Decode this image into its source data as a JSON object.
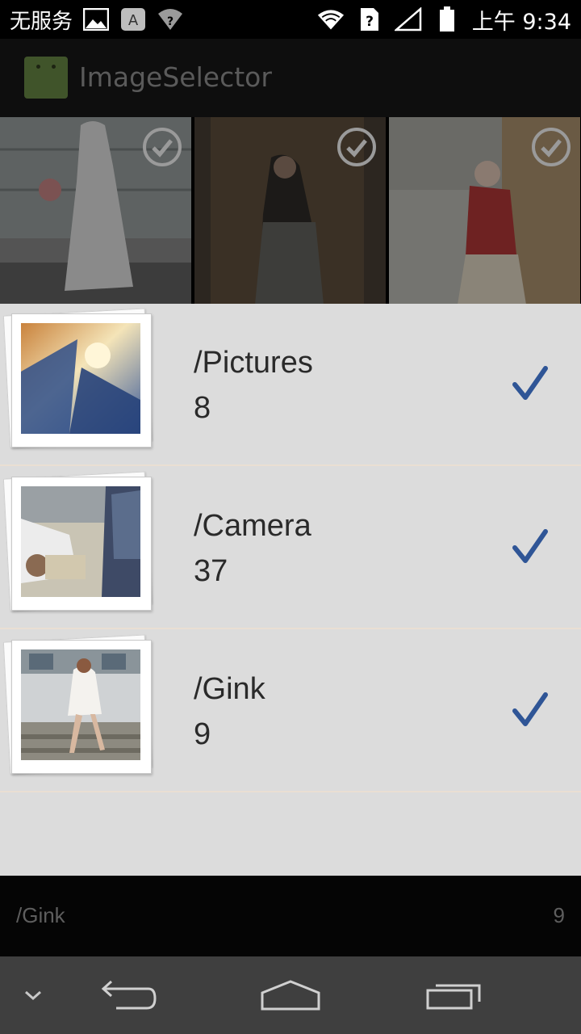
{
  "status_bar": {
    "carrier": "无服务",
    "time": "上午 9:34",
    "icons": [
      "gallery-notification-icon",
      "keyboard-a-icon",
      "wifi-question-icon",
      "wifi-icon",
      "sim-unknown-icon",
      "signal-icon",
      "battery-icon"
    ]
  },
  "action_bar": {
    "title": "ImageSelector",
    "icon": "android-app-icon"
  },
  "grid": {
    "thumbnails": [
      "photo-woman-white-dress",
      "photo-woman-dark-room",
      "photo-woman-red-sweater"
    ]
  },
  "folders": [
    {
      "name": "/Pictures",
      "count": "8",
      "selected": true
    },
    {
      "name": "/Camera",
      "count": "37",
      "selected": true
    },
    {
      "name": "/Gink",
      "count": "9",
      "selected": true
    }
  ],
  "bottom_bar": {
    "current_dir": "/Gink",
    "image_count": "9"
  },
  "nav_bar": {
    "buttons": [
      "collapse-icon",
      "back-icon",
      "home-icon",
      "recent-apps-icon"
    ]
  },
  "colors": {
    "panel_bg": "#dcdcdc",
    "check_blue": "#2f5596",
    "divider": "#eadfd3"
  }
}
